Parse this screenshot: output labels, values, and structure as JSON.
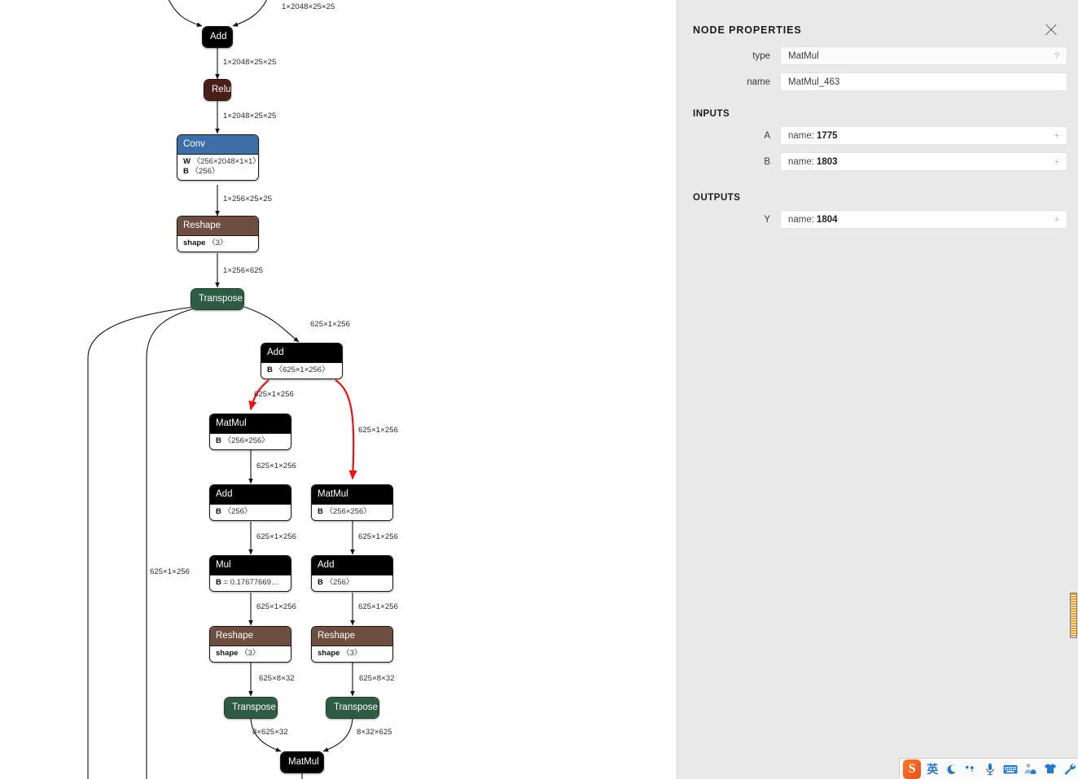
{
  "app": {
    "canvas_background": "#ffffff",
    "panel_background": "#e9e9e9",
    "selected_edge_color": "#ee1111"
  },
  "graph": {
    "nodes": [
      {
        "id": "add_top",
        "type": "Add",
        "category": "layer",
        "attrs": []
      },
      {
        "id": "relu",
        "type": "Relu",
        "category": "relu",
        "attrs": []
      },
      {
        "id": "conv",
        "type": "Conv",
        "category": "conv",
        "attrs": [
          {
            "key": "W",
            "value": "〈256×2048×1×1〉"
          },
          {
            "key": "B",
            "value": "〈256〉"
          }
        ]
      },
      {
        "id": "reshape_1",
        "type": "Reshape",
        "category": "reshape",
        "attrs": [
          {
            "key": "shape",
            "value": "〈3〉"
          }
        ]
      },
      {
        "id": "transpose_1",
        "type": "Transpose",
        "category": "transpose",
        "attrs": []
      },
      {
        "id": "add_2",
        "type": "Add",
        "category": "layer",
        "attrs": [
          {
            "key": "B",
            "value": "〈625×1×256〉"
          }
        ]
      },
      {
        "id": "matmul_left",
        "type": "MatMul",
        "category": "layer",
        "attrs": [
          {
            "key": "B",
            "value": "〈256×256〉"
          }
        ]
      },
      {
        "id": "matmul_right",
        "type": "MatMul",
        "category": "layer",
        "attrs": [
          {
            "key": "B",
            "value": "〈256×256〉"
          }
        ]
      },
      {
        "id": "add_left",
        "type": "Add",
        "category": "layer",
        "attrs": [
          {
            "key": "B",
            "value": "〈256〉"
          }
        ]
      },
      {
        "id": "add_right",
        "type": "Add",
        "category": "layer",
        "attrs": [
          {
            "key": "B",
            "value": "〈256〉"
          }
        ]
      },
      {
        "id": "mul_left",
        "type": "Mul",
        "category": "layer",
        "attrs": [
          {
            "key": "B",
            "value": "= 0.17677669…"
          }
        ]
      },
      {
        "id": "reshape_left",
        "type": "Reshape",
        "category": "reshape",
        "attrs": [
          {
            "key": "shape",
            "value": "〈3〉"
          }
        ]
      },
      {
        "id": "reshape_right",
        "type": "Reshape",
        "category": "reshape",
        "attrs": [
          {
            "key": "shape",
            "value": "〈3〉"
          }
        ]
      },
      {
        "id": "transpose_left",
        "type": "Transpose",
        "category": "transpose",
        "attrs": []
      },
      {
        "id": "transpose_right",
        "type": "Transpose",
        "category": "transpose",
        "attrs": []
      },
      {
        "id": "matmul_bottom",
        "type": "MatMul",
        "category": "layer",
        "attrs": []
      }
    ],
    "edge_labels": [
      {
        "id": "l_top_right",
        "text": "1×2048×25×25"
      },
      {
        "id": "l_add_relu",
        "text": "1×2048×25×25"
      },
      {
        "id": "l_relu_conv",
        "text": "1×2048×25×25"
      },
      {
        "id": "l_conv_reshape",
        "text": "1×256×25×25"
      },
      {
        "id": "l_reshape_trans",
        "text": "1×256×625"
      },
      {
        "id": "l_trans_add",
        "text": "625×1×256"
      },
      {
        "id": "l_add_matmulL",
        "text": "625×1×256"
      },
      {
        "id": "l_add_matmulR",
        "text": "625×1×256"
      },
      {
        "id": "l_matmulL_addL",
        "text": "625×1×256"
      },
      {
        "id": "l_matmulR_addR",
        "text": "625×1×256"
      },
      {
        "id": "l_addL_mulL",
        "text": "625×1×256"
      },
      {
        "id": "l_addR_reshapeR",
        "text": "625×1×256"
      },
      {
        "id": "l_mulL_reshapeL",
        "text": "625×1×256"
      },
      {
        "id": "l_far_left",
        "text": "625×1×256"
      },
      {
        "id": "l_reshapeL_transL",
        "text": "625×8×32"
      },
      {
        "id": "l_reshapeR_transR",
        "text": "625×8×32"
      },
      {
        "id": "l_transL_matmulB",
        "text": "8×625×32"
      },
      {
        "id": "l_transR_matmulB",
        "text": "8×32×625"
      }
    ]
  },
  "panel": {
    "title": "NODE PROPERTIES",
    "close_label": "×",
    "fields": [
      {
        "label": "type",
        "value": "MatMul",
        "trailing": "?"
      },
      {
        "label": "name",
        "value": "MatMul_463",
        "trailing": ""
      }
    ],
    "inputs_title": "INPUTS",
    "inputs": [
      {
        "label": "A",
        "name_prefix": "name:",
        "name_value": "1775",
        "trailing": "+"
      },
      {
        "label": "B",
        "name_prefix": "name:",
        "name_value": "1803",
        "trailing": "+"
      }
    ],
    "outputs_title": "OUTPUTS",
    "outputs": [
      {
        "label": "Y",
        "name_prefix": "name:",
        "name_value": "1804",
        "trailing": "+"
      }
    ]
  },
  "ime": {
    "logo": "S",
    "language": "英",
    "items": [
      {
        "name": "moon-icon",
        "glyph": "☾"
      },
      {
        "name": "punctuation-icon",
        "glyph": "·,"
      },
      {
        "name": "microphone-icon",
        "glyph": "🎤"
      },
      {
        "name": "keyboard-icon",
        "glyph": "⌨"
      },
      {
        "name": "toolbox-icon",
        "glyph": "🧰"
      },
      {
        "name": "skin-icon",
        "glyph": "👕"
      },
      {
        "name": "settings-wrench-icon",
        "glyph": "🔧"
      }
    ]
  }
}
